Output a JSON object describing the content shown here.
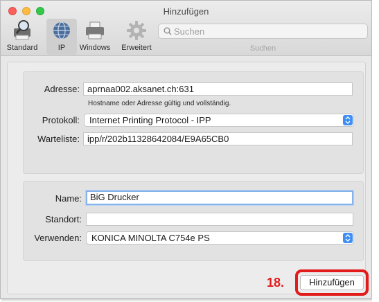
{
  "window": {
    "title": "Hinzufügen"
  },
  "toolbar": {
    "items": [
      {
        "label": "Standard",
        "icon": "printer-magnifier-icon"
      },
      {
        "label": "IP",
        "icon": "globe-icon",
        "selected": true
      },
      {
        "label": "Windows",
        "icon": "printer-icon"
      },
      {
        "label": "Erweitert",
        "icon": "gear-icon"
      }
    ],
    "search": {
      "placeholder": "Suchen",
      "label": "Suchen"
    }
  },
  "connection": {
    "address_label": "Adresse:",
    "address_value": "aprnaa002.aksanet.ch:631",
    "hint": "Hostname oder Adresse gültig und vollständig.",
    "protocol_label": "Protokoll:",
    "protocol_value": "Internet Printing Protocol - IPP",
    "queue_label": "Warteliste:",
    "queue_value": "ipp/r/202b11328642084/E9A65CB0"
  },
  "printer": {
    "name_label": "Name:",
    "name_value": "BiG Drucker",
    "location_label": "Standort:",
    "location_value": "",
    "use_label": "Verwenden:",
    "use_value": "KONICA MINOLTA C754e PS"
  },
  "actions": {
    "add_label": "Hinzufügen"
  },
  "annotation": {
    "step": "18.",
    "color": "#e21b1b"
  },
  "colors": {
    "accent": "#3f8ef3",
    "focus": "#86b3ea"
  }
}
